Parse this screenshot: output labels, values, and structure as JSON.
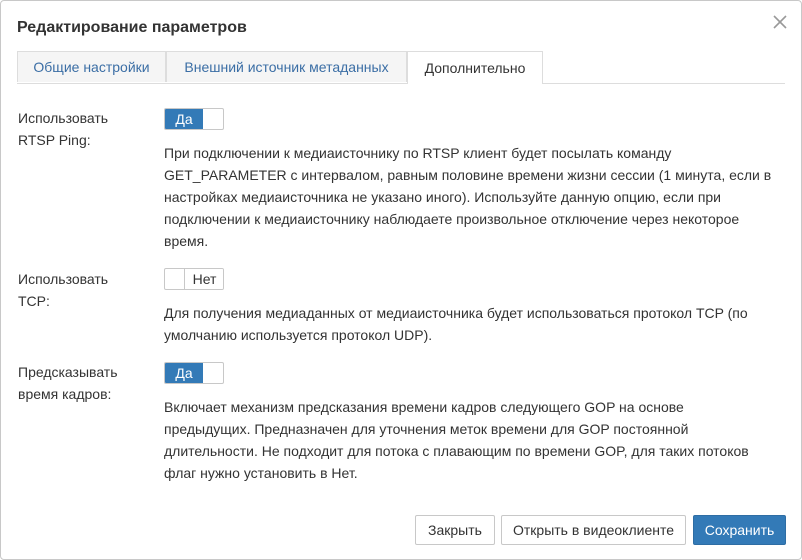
{
  "dialog": {
    "title": "Редактирование параметров",
    "close_icon": "close-icon"
  },
  "tabs": [
    {
      "label": "Общие настройки",
      "active": false
    },
    {
      "label": "Внешний источник метаданных",
      "active": false
    },
    {
      "label": "Дополнительно",
      "active": true
    }
  ],
  "settings": [
    {
      "label_line1": "Использовать",
      "label_line2": "RTSP Ping:",
      "toggle_value": "Да",
      "enabled": true,
      "description": "При подключении к медиаисточнику по RTSP клиент будет посылать команду GET_PARAMETER с интервалом, равным половине времени жизни сессии (1 минута, если в настройках медиаисточника не указано иного). Используйте данную опцию, если при подключении к медиаисточнику наблюдаете произвольное отключение через некоторое время."
    },
    {
      "label_line1": "Использовать",
      "label_line2": "TCP:",
      "toggle_value": "Нет",
      "enabled": false,
      "description": "Для получения медиаданных от медиаисточника будет использоваться протокол TCP (по умолчанию используется протокол UDP)."
    },
    {
      "label_line1": "Предсказывать",
      "label_line2": "время кадров:",
      "toggle_value": "Да",
      "enabled": true,
      "description": "Включает механизм предсказания времени кадров следующего GOP на основе предыдущих. Предназначен для уточнения меток времени для GOP постоянной длительности. Не подходит для потока с плавающим по времени GOP, для таких потоков флаг нужно установить в Нет."
    }
  ],
  "buttons": {
    "close": "Закрыть",
    "open_in_client": "Открыть в видеоклиенте",
    "save": "Сохранить"
  },
  "colors": {
    "accent": "#337ab7",
    "tab_link": "#3b6ea5",
    "border": "#c8c8c8"
  }
}
